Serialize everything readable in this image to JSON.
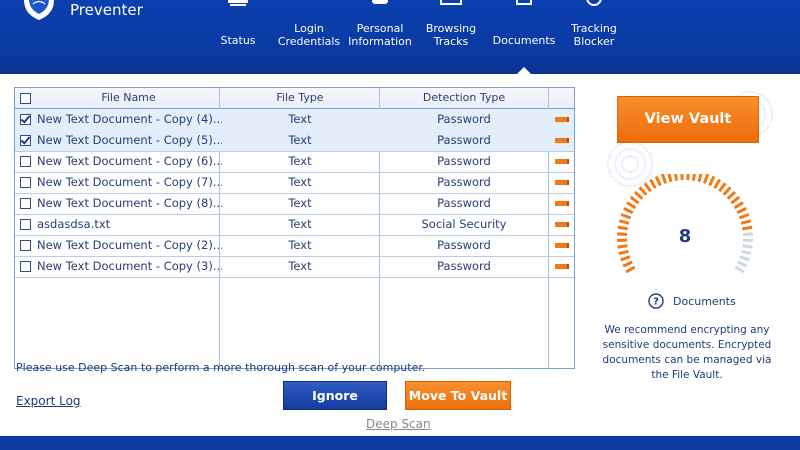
{
  "app": {
    "brand": "Preventer",
    "logo_icon": "shield-icon"
  },
  "nav": {
    "items": [
      {
        "label": "Status",
        "icon": "monitor-icon"
      },
      {
        "label": "Login\nCredentials",
        "icon": "key-icon"
      },
      {
        "label": "Personal\nInformation",
        "icon": "database-icon"
      },
      {
        "label": "Browsing\nTracks",
        "icon": "browser-icon"
      },
      {
        "label": "Documents",
        "icon": "document-icon",
        "active": true
      },
      {
        "label": "Tracking\nBlocker",
        "icon": "block-icon"
      }
    ]
  },
  "table": {
    "headers": {
      "name": "File Name",
      "type": "File Type",
      "detection": "Detection Type"
    },
    "rows": [
      {
        "name": "New Text Document - Copy (4)...",
        "type": "Text",
        "detection": "Password",
        "checked": true
      },
      {
        "name": "New Text Document - Copy (5)...",
        "type": "Text",
        "detection": "Password",
        "checked": true
      },
      {
        "name": "New Text Document - Copy (6)...",
        "type": "Text",
        "detection": "Password",
        "checked": false
      },
      {
        "name": "New Text Document - Copy (7)...",
        "type": "Text",
        "detection": "Password",
        "checked": false
      },
      {
        "name": "New Text Document - Copy (8)...",
        "type": "Text",
        "detection": "Password",
        "checked": false
      },
      {
        "name": "asdasdsa.txt",
        "type": "Text",
        "detection": "Social Security",
        "checked": false
      },
      {
        "name": "New Text Document - Copy (2)...",
        "type": "Text",
        "detection": "Password",
        "checked": false
      },
      {
        "name": "New Text Document - Copy (3)...",
        "type": "Text",
        "detection": "Password",
        "checked": false
      }
    ]
  },
  "deep_scan_note": "Please use Deep Scan to perform a more thorough scan of your computer.",
  "export_log": "Export Log",
  "buttons": {
    "ignore": "Ignore",
    "move": "Move To Vault",
    "deep_scan": "Deep Scan",
    "view_vault": "View Vault"
  },
  "vault": {
    "count": "8",
    "label": "Documents",
    "help_icon": "question-icon",
    "message": "We recommend encrypting any sensitive documents. Encrypted documents can be managed via the File Vault."
  },
  "colors": {
    "header_blue": "#0b3fb0",
    "accent_orange": "#f07a1a",
    "text_blue": "#1f3b7a"
  }
}
